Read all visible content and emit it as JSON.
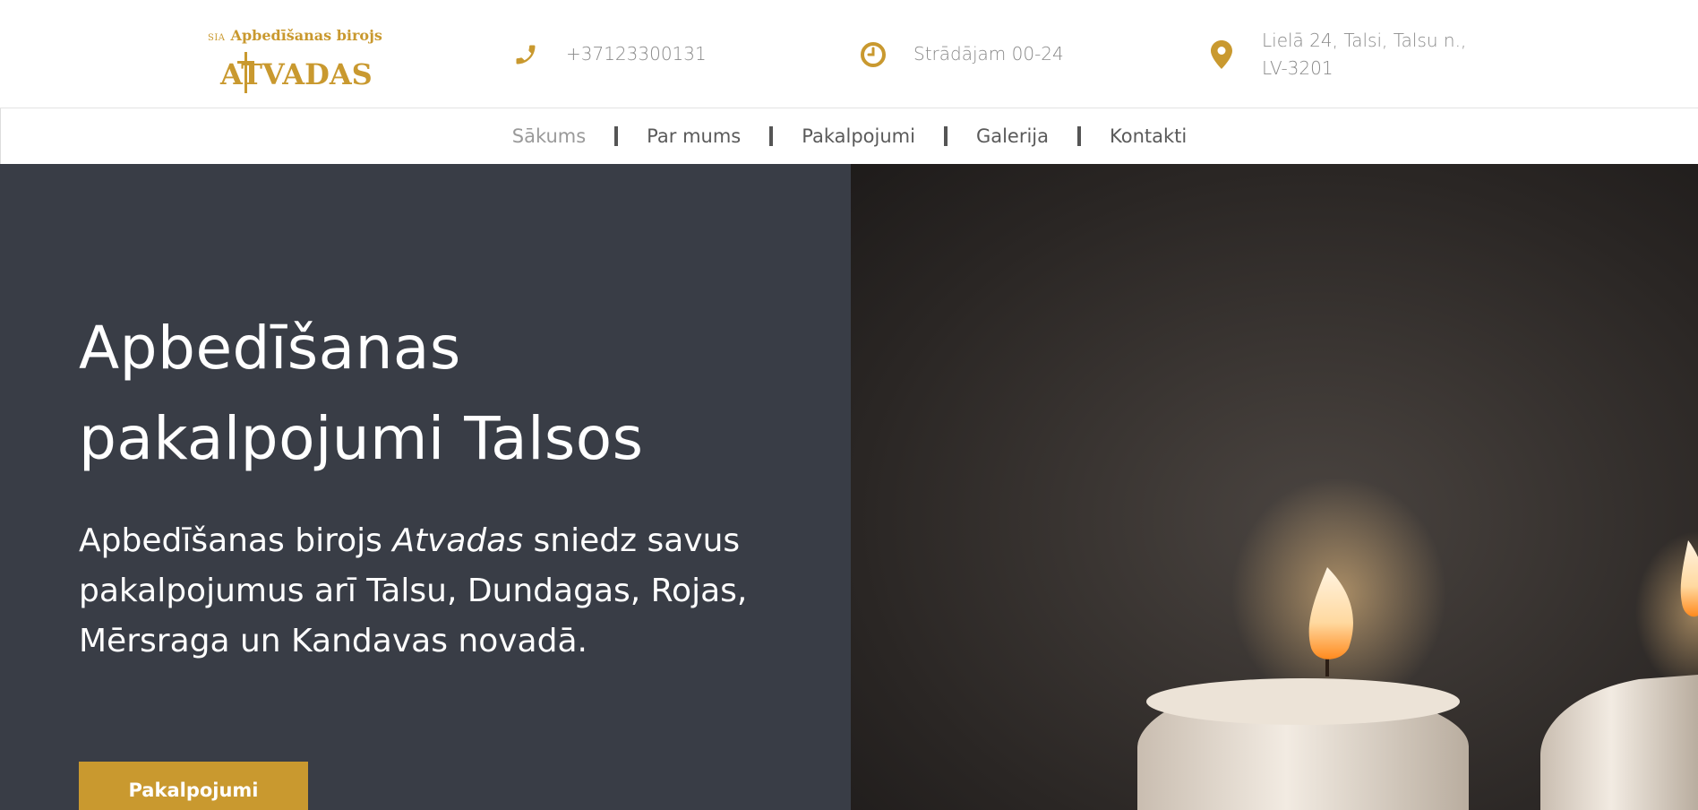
{
  "header": {
    "logo": {
      "sia": "SIA",
      "office": "Apbedīšanas birojs",
      "name": "ATVADAS"
    },
    "phone": {
      "icon": "phone-icon",
      "text": "+37123300131"
    },
    "hours": {
      "icon": "clock-icon",
      "text": "Strādājam 00-24"
    },
    "address": {
      "icon": "map-pin-icon",
      "line1": "Lielā 24, Talsi, Talsu n.,",
      "line2": "LV-3201"
    },
    "accent_color": "#c9992f"
  },
  "nav": {
    "items": [
      {
        "label": "Sākums",
        "active": true
      },
      {
        "label": "Par mums",
        "active": false
      },
      {
        "label": "Pakalpojumi",
        "active": false
      },
      {
        "label": "Galerija",
        "active": false
      },
      {
        "label": "Kontakti",
        "active": false
      }
    ]
  },
  "hero": {
    "title_line1": "Apbedīšanas",
    "title_line2": "pakalpojumi Talsos",
    "lead_before": "Apbedīšanas birojs ",
    "lead_em": "Atvadas",
    "lead_after": " sniedz savus pakalpojumus arī Talsu, Dundagas, Rojas, Mērsraga un Kandavas novadā.",
    "button_label": "Pakalpojumi",
    "panel_color": "#393d46",
    "image": "candles-photo"
  }
}
